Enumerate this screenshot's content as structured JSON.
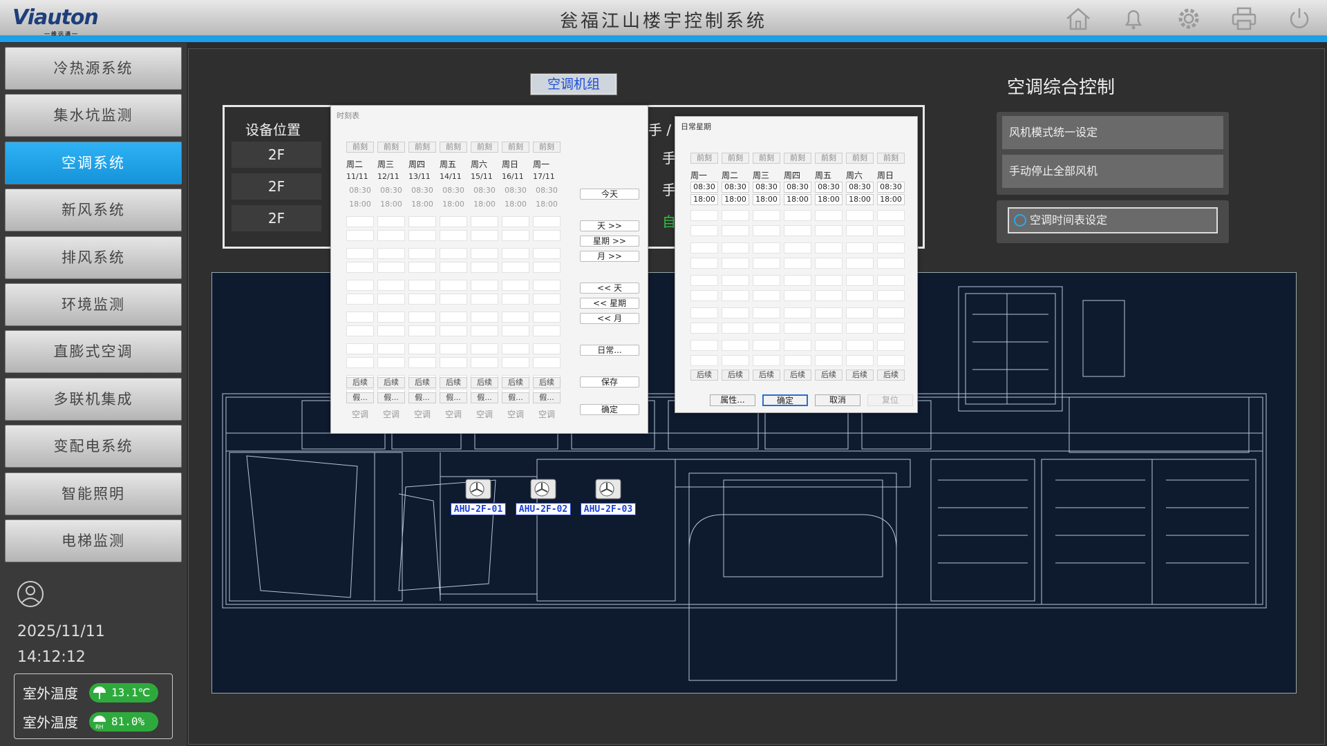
{
  "app": {
    "logo": "Viauton",
    "logo_sub": "一维远通一",
    "title": "瓮福江山楼宇控制系统",
    "top_icons": [
      "home-icon",
      "bell-icon",
      "gear-icon",
      "printer-icon",
      "power-icon"
    ]
  },
  "nav": {
    "items": [
      {
        "label": "冷热源系统",
        "active": false
      },
      {
        "label": "集水坑监测",
        "active": false
      },
      {
        "label": "空调系统",
        "active": true
      },
      {
        "label": "新风系统",
        "active": false
      },
      {
        "label": "排风系统",
        "active": false
      },
      {
        "label": "环境监测",
        "active": false
      },
      {
        "label": "直膨式空调",
        "active": false
      },
      {
        "label": "多联机集成",
        "active": false
      },
      {
        "label": "变配电系统",
        "active": false
      },
      {
        "label": "智能照明",
        "active": false
      },
      {
        "label": "电梯监测",
        "active": false
      }
    ]
  },
  "status": {
    "date": "2025/11/11",
    "time": "14:12:12",
    "weather": [
      {
        "label": "室外温度",
        "value": "13.1℃"
      },
      {
        "label": "室外温度",
        "value": "81.0%"
      }
    ]
  },
  "main": {
    "unit_button": "空调机组",
    "device_header": "设备位置",
    "devices": [
      "2F",
      "2F",
      "2F"
    ],
    "mode_fragments": [
      "手 /",
      "手",
      "手",
      "自"
    ],
    "control_title": "空调综合控制",
    "controls": [
      "风机模式统一设定",
      "手动停止全部风机"
    ],
    "schedule_button": "空调时间表设定",
    "ahus": [
      "AHU-2F-01",
      "AHU-2F-02",
      "AHU-2F-03"
    ]
  },
  "schedule_dialog": {
    "title": "时刻表",
    "header_btn": "前刻",
    "days": [
      "周二",
      "周三",
      "周四",
      "周五",
      "周六",
      "周日",
      "周一"
    ],
    "dates": [
      "11/11",
      "12/11",
      "13/11",
      "14/11",
      "15/11",
      "16/11",
      "17/11"
    ],
    "times": [
      "08:30",
      "18:00"
    ],
    "after_btn": "后续",
    "holiday_btn": "假...",
    "footer": "空调",
    "side_buttons": [
      "今天",
      "天 >>",
      "星期 >>",
      "月 >>",
      "<< 天",
      "<< 星期",
      "<< 月",
      "日常...",
      "保存",
      "确定"
    ]
  },
  "weekly_dialog": {
    "title": "日常星期",
    "header_btn": "前刻",
    "days": [
      "周一",
      "周二",
      "周三",
      "周四",
      "周五",
      "周六",
      "周日"
    ],
    "times": [
      "08:30",
      "18:00"
    ],
    "after_btn": "后续",
    "buttons": [
      "属性...",
      "确定",
      "取消",
      "复位"
    ]
  }
}
